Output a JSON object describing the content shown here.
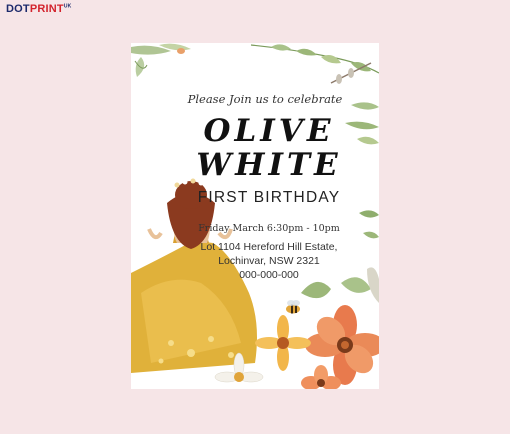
{
  "brand": {
    "part1": "DOT",
    "part2": "PRINT",
    "suffix": "UK"
  },
  "invitation": {
    "intro": "Please Join us to celebrate",
    "name_line1": "OLIVE",
    "name_line2": "WHITE",
    "occasion": "FIRST BIRTHDAY",
    "date_time": "Friday March 6:30pm - 10pm",
    "address_line1": "Lot 1104 Hereford Hill Estate,",
    "address_line2": "Lochinvar, NSW 2321",
    "phone": "000-000-000"
  },
  "colors": {
    "page_bg": "#f6e5e7",
    "card_bg": "#ffffff",
    "dress_gold": "#e0b13a",
    "hair": "#8b3a1f",
    "flower_orange": "#e87a4d",
    "leaf_green": "#8fae6d"
  }
}
